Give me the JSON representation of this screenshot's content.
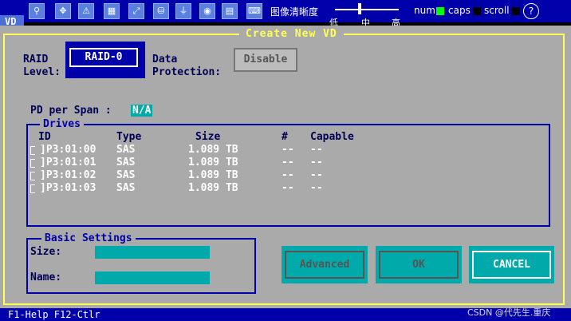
{
  "toolbar": {
    "clarity_label": "图像清晰度",
    "slider_low": "低",
    "slider_mid": "中",
    "slider_high": "高",
    "num_label": "num",
    "caps_label": "caps",
    "scroll_label": "scroll",
    "help_label": "?",
    "colors": {
      "num": "#00ff00",
      "caps": "#000000",
      "scroll": "#000000"
    }
  },
  "tab": {
    "label": "VD"
  },
  "dialog": {
    "title": "Create New VD",
    "raid_label_1": "RAID",
    "raid_label_2": "Level:",
    "raid_value": "RAID-0",
    "protection_label_1": "Data",
    "protection_label_2": "Protection:",
    "protection_value": "Disable",
    "pd_span_label": "PD per Span :",
    "pd_span_value": "N/A",
    "drives": {
      "title": "Drives",
      "columns": [
        "ID",
        "Type",
        "Size",
        "#",
        "Capable"
      ],
      "rows": [
        {
          "id": "]P3:01:00",
          "type": "SAS",
          "size": "1.089 TB",
          "num": "--",
          "capable": "--"
        },
        {
          "id": "]P3:01:01",
          "type": "SAS",
          "size": "1.089 TB",
          "num": "--",
          "capable": "--"
        },
        {
          "id": "]P3:01:02",
          "type": "SAS",
          "size": "1.089 TB",
          "num": "--",
          "capable": "--"
        },
        {
          "id": "]P3:01:03",
          "type": "SAS",
          "size": "1.089 TB",
          "num": "--",
          "capable": "--"
        }
      ]
    },
    "basic": {
      "title": "Basic Settings",
      "size_label": "Size:",
      "name_label": "Name:",
      "size_value": "",
      "name_value": ""
    },
    "buttons": {
      "advanced": "Advanced",
      "ok": "OK",
      "cancel": "CANCEL"
    }
  },
  "bottom": {
    "help": "F1-Help F12-Ctlr",
    "watermark": "CSDN @代先生.重庆"
  }
}
